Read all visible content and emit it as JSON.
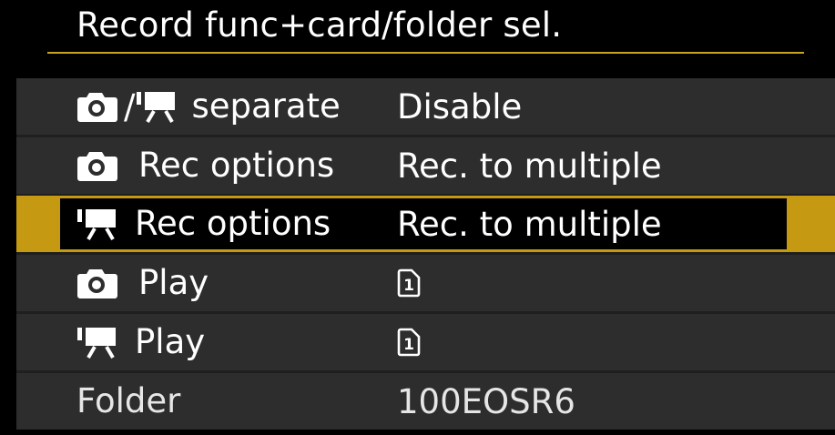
{
  "title": "Record func+card/folder sel.",
  "colors": {
    "accent": "#c59a12",
    "row_bg": "#2d2d2d",
    "background": "#000000"
  },
  "rows": [
    {
      "icons": [
        "camera-icon",
        "movie-camera-icon"
      ],
      "separator": "/",
      "label": "separate",
      "value": "Disable"
    },
    {
      "icons": [
        "camera-icon"
      ],
      "label": "Rec options",
      "value": "Rec. to multiple"
    },
    {
      "icons": [
        "movie-camera-icon"
      ],
      "label": "Rec options",
      "value": "Rec. to multiple",
      "selected": true
    },
    {
      "icons": [
        "camera-icon"
      ],
      "label": "Play",
      "value_icon": "card-1-icon",
      "value_text": "1"
    },
    {
      "icons": [
        "movie-camera-icon"
      ],
      "label": "Play",
      "value_icon": "card-1-icon",
      "value_text": "1"
    },
    {
      "icons": [],
      "label": "Folder",
      "value": "100EOSR6"
    }
  ]
}
